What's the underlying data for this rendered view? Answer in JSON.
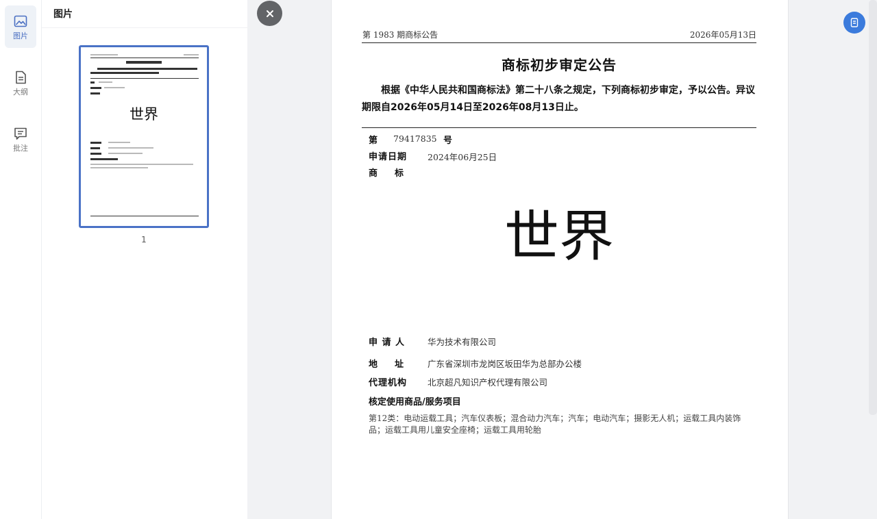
{
  "sidebar": {
    "items": [
      {
        "label": "图片",
        "icon": "image-icon",
        "active": true
      },
      {
        "label": "大纲",
        "icon": "outline-icon",
        "active": false
      },
      {
        "label": "批注",
        "icon": "comment-icon",
        "active": false
      }
    ]
  },
  "thumbnails": {
    "title": "图片",
    "pages": [
      {
        "number": "1",
        "preview_text": "世界"
      }
    ]
  },
  "document": {
    "header_left": "第 1983 期商标公告",
    "header_right": "2026年05月13日",
    "title": "商标初步审定公告",
    "intro": "根据《中华人民共和国商标法》第二十八条之规定，下列商标初步审定，予以公告。异议期限自2026年05月14日至2026年08月13日止。",
    "number_label": "第",
    "number_value": "79417835",
    "number_suffix": "号",
    "date_label": "申请日期",
    "date_value": "2024年06月25日",
    "mark_label": "商　标",
    "mark": "世界",
    "applicant_label": "申 请 人",
    "applicant_value": "华为技术有限公司",
    "address_label": "地　址",
    "address_value": "广东省深圳市龙岗区坂田华为总部办公楼",
    "agency_label": "代理机构",
    "agency_value": "北京超凡知识产权代理有限公司",
    "goods_heading": "核定使用商品/服务项目",
    "goods_text": "第12类：电动运载工具；汽车仪表板；混合动力汽车；汽车；电动汽车；摄影无人机；运载工具内装饰品；运载工具用儿童安全座椅；运载工具用轮胎"
  },
  "colors": {
    "accent": "#4a72c6",
    "action_button": "#3b7bdc",
    "close_button": "#626467"
  }
}
